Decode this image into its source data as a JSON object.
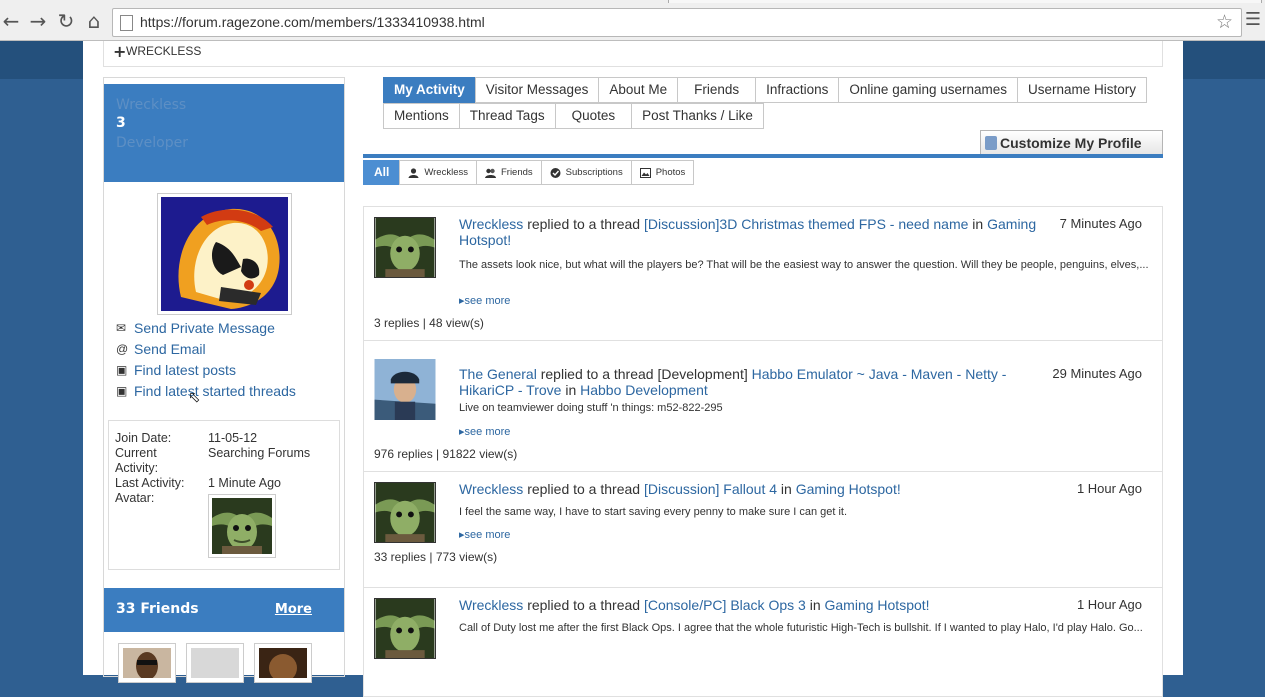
{
  "browser": {
    "url": "https://forum.ragezone.com/members/1333410938.html",
    "back_icon": "arrow-left-icon",
    "forward_icon": "arrow-right-icon",
    "reload_icon": "reload-icon",
    "home_icon": "home-icon",
    "star_icon": "star-icon",
    "menu_icon": "hamburger-icon"
  },
  "breadcrumb": {
    "label": "WRECKLESS"
  },
  "profile": {
    "username": "Wreckless",
    "title": "3",
    "usergroup": "Developer",
    "actions": [
      {
        "label": "Send Private Message",
        "icon": "envelope-icon"
      },
      {
        "label": "Send Email",
        "icon": "at-icon"
      },
      {
        "label": "Find latest posts",
        "icon": "posts-icon"
      },
      {
        "label": "Find latest started threads",
        "icon": "threads-icon"
      }
    ],
    "info": {
      "join_date_label": "Join Date:",
      "join_date": "11-05-12",
      "current_activity_label": "Current Activity:",
      "current_activity": "Searching Forums",
      "last_activity_label": "Last Activity:",
      "last_activity": "1 Minute Ago",
      "avatar_label": "Avatar:"
    },
    "friends": {
      "title": "33 Friends",
      "more": "More"
    }
  },
  "tabs": {
    "row1": [
      "My Activity",
      "Visitor Messages",
      "About Me",
      "Friends",
      "Infractions",
      "Online gaming usernames",
      "Username History"
    ],
    "row2": [
      "Mentions",
      "Thread Tags",
      "Quotes",
      "Post Thanks / Like"
    ],
    "active": "My Activity",
    "customize": "Customize My Profile"
  },
  "filters": [
    {
      "label": "All",
      "icon": ""
    },
    {
      "label": "Wreckless",
      "icon": "user-icon"
    },
    {
      "label": "Friends",
      "icon": "friends-icon"
    },
    {
      "label": "Subscriptions",
      "icon": "check-circle-icon"
    },
    {
      "label": "Photos",
      "icon": "photo-icon"
    }
  ],
  "feed": [
    {
      "user": "Wreckless",
      "verb": " replied to a thread ",
      "thread": "[Discussion]3D Christmas themed FPS - need name",
      "in": " in ",
      "forum": "Gaming Hotspot!",
      "time": "7 Minutes Ago",
      "body": "The assets look nice, but what will the players be? That will be the easiest way to answer the question. Will they be people, penguins, elves,...",
      "see_more": "see more",
      "stats": "3 replies | 48 view(s)"
    },
    {
      "user": "The General",
      "verb": " replied to a thread [Development] ",
      "thread": "Habbo Emulator ~ Java - Maven - Netty - HikariCP - Trove",
      "in": " in ",
      "forum": "Habbo Development",
      "time": "29 Minutes Ago",
      "body": "Live on teamviewer doing stuff 'n things: m52-822-295",
      "see_more": "see more",
      "stats": "976 replies | 91822 view(s)"
    },
    {
      "user": "Wreckless",
      "verb": " replied to a thread ",
      "thread": "[Discussion] Fallout 4",
      "in": " in ",
      "forum": "Gaming Hotspot!",
      "time": "1 Hour Ago",
      "body": "I feel the same way, I have to start saving every penny to make sure I can get it.",
      "see_more": "see more",
      "stats": "33 replies | 773 view(s)"
    },
    {
      "user": "Wreckless",
      "verb": " replied to a thread ",
      "thread": "[Console/PC] Black Ops 3",
      "in": " in ",
      "forum": "Gaming Hotspot!",
      "time": "1 Hour Ago",
      "body": "Call of Duty lost me after the first Black Ops. I agree that the whole futuristic High-Tech is bullshit. If I wanted to play Halo, I'd play Halo. Go...",
      "see_more": "see more",
      "stats": ""
    }
  ],
  "colors": {
    "accent": "#3b7dc0",
    "link": "#2d67a1",
    "page_bg": "#2f5f91"
  }
}
